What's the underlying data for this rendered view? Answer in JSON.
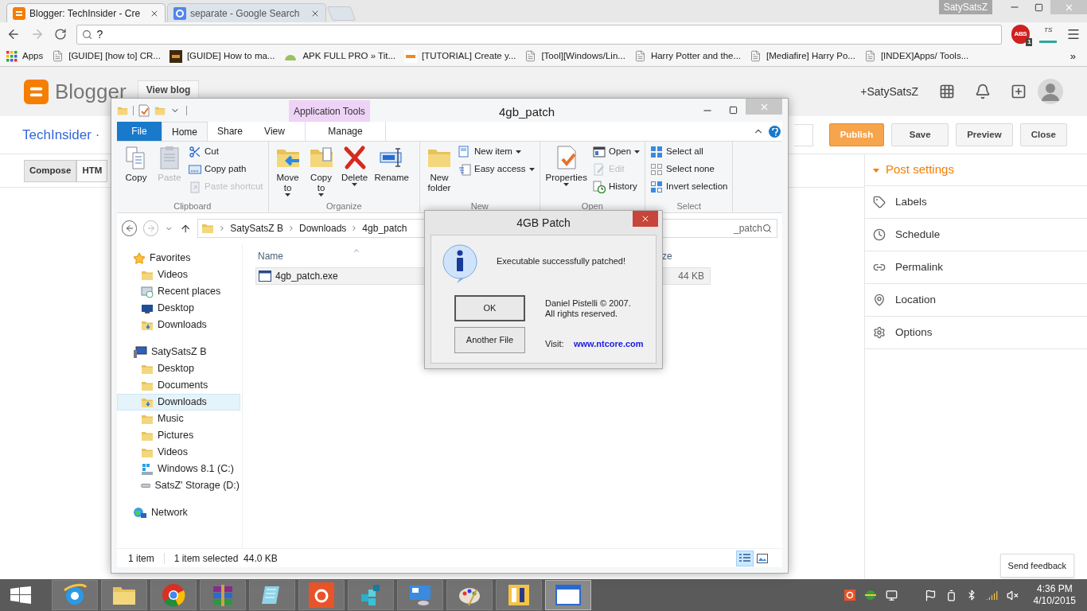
{
  "browser": {
    "tabs": [
      {
        "title": "Blogger: TechInsider - Cre",
        "kind": "blogger",
        "selected": true
      },
      {
        "title": "separate - Google Search",
        "kind": "google",
        "selected": false
      }
    ],
    "profile": "SatySatsZ",
    "address": "?",
    "extensions": [
      {
        "kind": "adblock",
        "label": "ABS",
        "badge": "1"
      },
      {
        "kind": "ts",
        "label": "TS"
      }
    ],
    "bookmarks": [
      {
        "label": "Apps",
        "kind": "apps"
      },
      {
        "label": "[GUIDE] [how to] CR...",
        "kind": "page"
      },
      {
        "label": "[GUIDE] How to ma...",
        "kind": "xda"
      },
      {
        "label": "APK FULL PRO » Tit...",
        "kind": "android"
      },
      {
        "label": "[TUTORIAL] Create y...",
        "kind": "xda2"
      },
      {
        "label": "[Tool][Windows/Lin...",
        "kind": "page"
      },
      {
        "label": "Harry Potter and the...",
        "kind": "page"
      },
      {
        "label": "[Mediafire] Harry Po...",
        "kind": "page"
      },
      {
        "label": "[INDEX]Apps/ Tools...",
        "kind": "page"
      }
    ],
    "more": "»"
  },
  "blogger": {
    "logo": "Blogger",
    "view_blog": "View blog",
    "account": "+SatySatsZ",
    "blog_title": "TechInsider ·",
    "actions": [
      {
        "label": "Publish",
        "kind": "primary"
      },
      {
        "label": "Save",
        "kind": "plain"
      },
      {
        "label": "Preview",
        "kind": "plain"
      },
      {
        "label": "Close",
        "kind": "plain"
      }
    ],
    "editor_tabs": [
      {
        "label": "Compose",
        "selected": true
      },
      {
        "label": "HTM",
        "selected": false
      }
    ],
    "post_settings": {
      "title": "Post settings",
      "expanded": true,
      "items": [
        {
          "label": "Labels",
          "kind": "tag"
        },
        {
          "label": "Schedule",
          "kind": "clock"
        },
        {
          "label": "Permalink",
          "kind": "link"
        },
        {
          "label": "Location",
          "kind": "pin"
        },
        {
          "label": "Options",
          "kind": "gear"
        }
      ]
    },
    "feedback": "Send feedback"
  },
  "explorer": {
    "title": "4gb_patch",
    "context_group": "Application Tools",
    "tabs": [
      {
        "label": "File",
        "kind": "file",
        "selected": false
      },
      {
        "label": "Home",
        "kind": "tab",
        "selected": true
      },
      {
        "label": "Share",
        "kind": "tab",
        "selected": false
      },
      {
        "label": "View",
        "kind": "tab",
        "selected": false
      },
      {
        "label": "Manage",
        "kind": "context",
        "selected": false
      }
    ],
    "ribbon": [
      {
        "label": "Clipboard",
        "items": [
          {
            "label": "Copy",
            "kind": "copy",
            "large": true,
            "disabled": false,
            "dropdown": false
          },
          {
            "label": "Paste",
            "kind": "paste",
            "large": true,
            "disabled": true,
            "dropdown": false
          },
          {
            "label": "Cut",
            "kind": "cut",
            "large": false,
            "disabled": false,
            "dropdown": false
          },
          {
            "label": "Copy path",
            "kind": "copypath",
            "large": false,
            "disabled": false,
            "dropdown": false
          },
          {
            "label": "Paste shortcut",
            "kind": "pasteshortcut",
            "large": false,
            "disabled": true,
            "dropdown": false
          }
        ]
      },
      {
        "label": "Organize",
        "items": [
          {
            "label": "Move to",
            "kind": "moveto",
            "large": true,
            "disabled": false,
            "dropdown": true
          },
          {
            "label": "Copy to",
            "kind": "copyto",
            "large": true,
            "disabled": false,
            "dropdown": true
          },
          {
            "label": "Delete",
            "kind": "delete",
            "large": true,
            "disabled": false,
            "dropdown": true
          },
          {
            "label": "Rename",
            "kind": "rename",
            "large": true,
            "disabled": false,
            "dropdown": false
          }
        ]
      },
      {
        "label": "New",
        "items": [
          {
            "label": "New folder",
            "kind": "newfolder",
            "large": true,
            "disabled": false,
            "dropdown": false
          },
          {
            "label": "New item",
            "kind": "newitem",
            "large": false,
            "disabled": false,
            "dropdown": true
          },
          {
            "label": "Easy access",
            "kind": "easyaccess",
            "large": false,
            "disabled": false,
            "dropdown": true
          }
        ]
      },
      {
        "label": "Open",
        "items": [
          {
            "label": "Properties",
            "kind": "properties",
            "large": true,
            "disabled": false,
            "dropdown": true
          },
          {
            "label": "Open",
            "kind": "open",
            "large": false,
            "disabled": false,
            "dropdown": true
          },
          {
            "label": "Edit",
            "kind": "edit",
            "large": false,
            "disabled": true,
            "dropdown": false
          },
          {
            "label": "History",
            "kind": "history",
            "large": false,
            "disabled": false,
            "dropdown": false
          }
        ]
      },
      {
        "label": "Select",
        "items": [
          {
            "label": "Select all",
            "kind": "selectall",
            "large": false,
            "disabled": false,
            "dropdown": false
          },
          {
            "label": "Select none",
            "kind": "selectnone",
            "large": false,
            "disabled": false,
            "dropdown": false
          },
          {
            "label": "Invert selection",
            "kind": "invert",
            "large": false,
            "disabled": false,
            "dropdown": false
          }
        ]
      }
    ],
    "path": [
      "SatySatsZ B",
      "Downloads",
      "4gb_patch"
    ],
    "search": "_patch",
    "nav": [
      {
        "label": "Favorites",
        "kind": "star",
        "selected": false,
        "children": [
          {
            "label": "Videos",
            "kind": "folder",
            "selected": false
          },
          {
            "label": "Recent places",
            "kind": "recent",
            "selected": false
          },
          {
            "label": "Desktop",
            "kind": "desktop",
            "selected": false
          },
          {
            "label": "Downloads",
            "kind": "downloads",
            "selected": false
          }
        ]
      },
      {
        "label": "SatySatsZ B",
        "kind": "computer",
        "selected": false,
        "children": [
          {
            "label": "Desktop",
            "kind": "folder",
            "selected": false
          },
          {
            "label": "Documents",
            "kind": "folder",
            "selected": false
          },
          {
            "label": "Downloads",
            "kind": "downloads",
            "selected": true
          },
          {
            "label": "Music",
            "kind": "folder",
            "selected": false
          },
          {
            "label": "Pictures",
            "kind": "folder",
            "selected": false
          },
          {
            "label": "Videos",
            "kind": "folder",
            "selected": false
          },
          {
            "label": "Windows 8.1 (C:)",
            "kind": "drivec",
            "selected": false
          },
          {
            "label": "SatsZ' Storage (D:)",
            "kind": "drived",
            "selected": false
          }
        ]
      },
      {
        "label": "Network",
        "kind": "network",
        "selected": false
      }
    ],
    "columns": [
      "Name",
      "ze"
    ],
    "files": [
      {
        "name": "4gb_patch.exe",
        "size": "44 KB",
        "selected": true
      }
    ],
    "status": {
      "count": "1 item",
      "selection": "1 item selected  44.0 KB"
    },
    "views": [
      {
        "kind": "details",
        "selected": true
      },
      {
        "kind": "large",
        "selected": false
      }
    ]
  },
  "dialog": {
    "title": "4GB Patch",
    "message": "Executable successfully patched!",
    "buttons": [
      "OK",
      "Another File"
    ],
    "copyright": "Daniel Pistelli © 2007.",
    "rights": "All rights reserved.",
    "visit": "Visit:",
    "link": "www.ntcore.com"
  },
  "taskbar": {
    "apps": [
      {
        "kind": "ie",
        "selected": false
      },
      {
        "kind": "explorer",
        "selected": false
      },
      {
        "kind": "chrome",
        "selected": false
      },
      {
        "kind": "winrar",
        "selected": false
      },
      {
        "kind": "notepad",
        "selected": false
      },
      {
        "kind": "recorder",
        "selected": false
      },
      {
        "kind": "cubes",
        "selected": false
      },
      {
        "kind": "panel",
        "selected": false
      },
      {
        "kind": "paint",
        "selected": false
      },
      {
        "kind": "kj",
        "selected": false
      },
      {
        "kind": "window",
        "selected": true
      }
    ],
    "time": "4:36 PM",
    "date": "4/10/2015"
  }
}
